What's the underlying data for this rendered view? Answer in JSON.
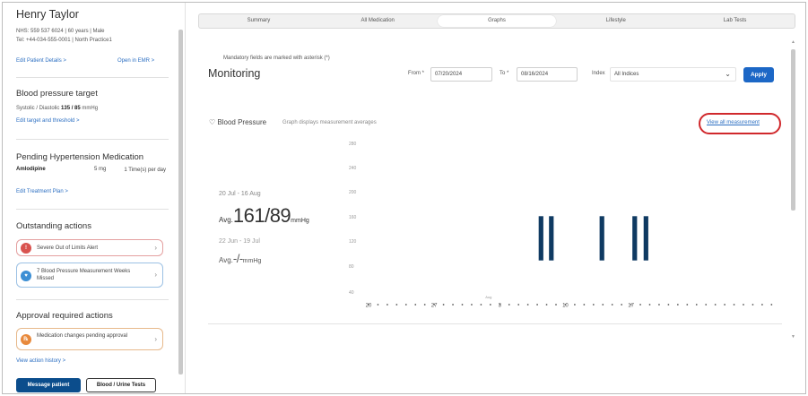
{
  "patient": {
    "name": "Henry Taylor",
    "meta_line1": "NHS: 559 537 6024 | 60 years | Male",
    "meta_line2": "Tel: +44-034-555-0001 | North Practice1",
    "edit_details": "Edit Patient Details >",
    "open_emr": "Open in EMR >"
  },
  "bp_target": {
    "title": "Blood pressure target",
    "label": "Systolic / Diastolic",
    "value": "135 / 85",
    "unit": "mmHg",
    "edit_link": "Edit target and threshold >"
  },
  "pending": {
    "title": "Pending Hypertension Medication",
    "med_name": "Amlodipine",
    "med_dose": "5 mg",
    "med_freq": "1 Time(s) per day",
    "edit_link": "Edit Treatment Plan >"
  },
  "outstanding": {
    "title": "Outstanding actions",
    "items": [
      {
        "icon": "red-alert-icon",
        "text": "Severe Out of Limits Alert",
        "color": "#d9534f"
      },
      {
        "icon": "blue-bp-icon",
        "text": "7 Blood Pressure Measurement Weeks Missed",
        "color": "#3d8fd4"
      }
    ]
  },
  "approval": {
    "title": "Approval required actions",
    "items": [
      {
        "icon": "orange-med-icon",
        "text": "Medication changes pending approval",
        "color": "#e8893b"
      }
    ],
    "history_link": "View action history >"
  },
  "buttons": {
    "message": "Message patient",
    "tests": "Blood / Urine Tests"
  },
  "tabs": [
    "Summary",
    "All Medication",
    "Graphs",
    "Lifestyle",
    "Lab Tests"
  ],
  "active_tab": "Graphs",
  "form": {
    "mandatory": "Mandatory fields are marked with asterisk (*)",
    "title": "Monitoring",
    "from_label": "From *",
    "from_value": "07/20/2024",
    "to_label": "To *",
    "to_value": "08/16/2024",
    "index_label": "Index",
    "index_value": "All Indices",
    "apply": "Apply"
  },
  "bp_section": {
    "title": "Blood Pressure",
    "note": "Graph displays measurement averages",
    "view_all": "View all measurement"
  },
  "averages": [
    {
      "range": "20 Jul - 16 Aug",
      "prefix": "Avg.",
      "value": "161/89",
      "unit": "mmHg"
    },
    {
      "range": "22 Jun - 19 Jul",
      "prefix": "Avg.",
      "value": "-/-",
      "unit": "mmHg"
    }
  ],
  "chart_data": {
    "type": "bar",
    "ylim": [
      40,
      250
    ],
    "yticks": [
      40,
      80,
      120,
      160,
      200,
      240,
      280
    ],
    "ytick_labels": [
      "40",
      "80",
      "120",
      "160",
      "200",
      "240",
      "280"
    ],
    "x_labels": [
      "20",
      "27",
      "3",
      "10",
      "17"
    ],
    "x_month_label": "Aug",
    "bars": [
      {
        "day": "Aug 7",
        "low": 89,
        "high": 161
      },
      {
        "day": "Aug 8",
        "low": 89,
        "high": 161
      },
      {
        "day": "Aug 12",
        "low": 89,
        "high": 161
      },
      {
        "day": "Aug 14",
        "low": 89,
        "high": 161
      },
      {
        "day": "Aug 15",
        "low": 89,
        "high": 161
      }
    ],
    "bar_color": "#0f3a62"
  }
}
